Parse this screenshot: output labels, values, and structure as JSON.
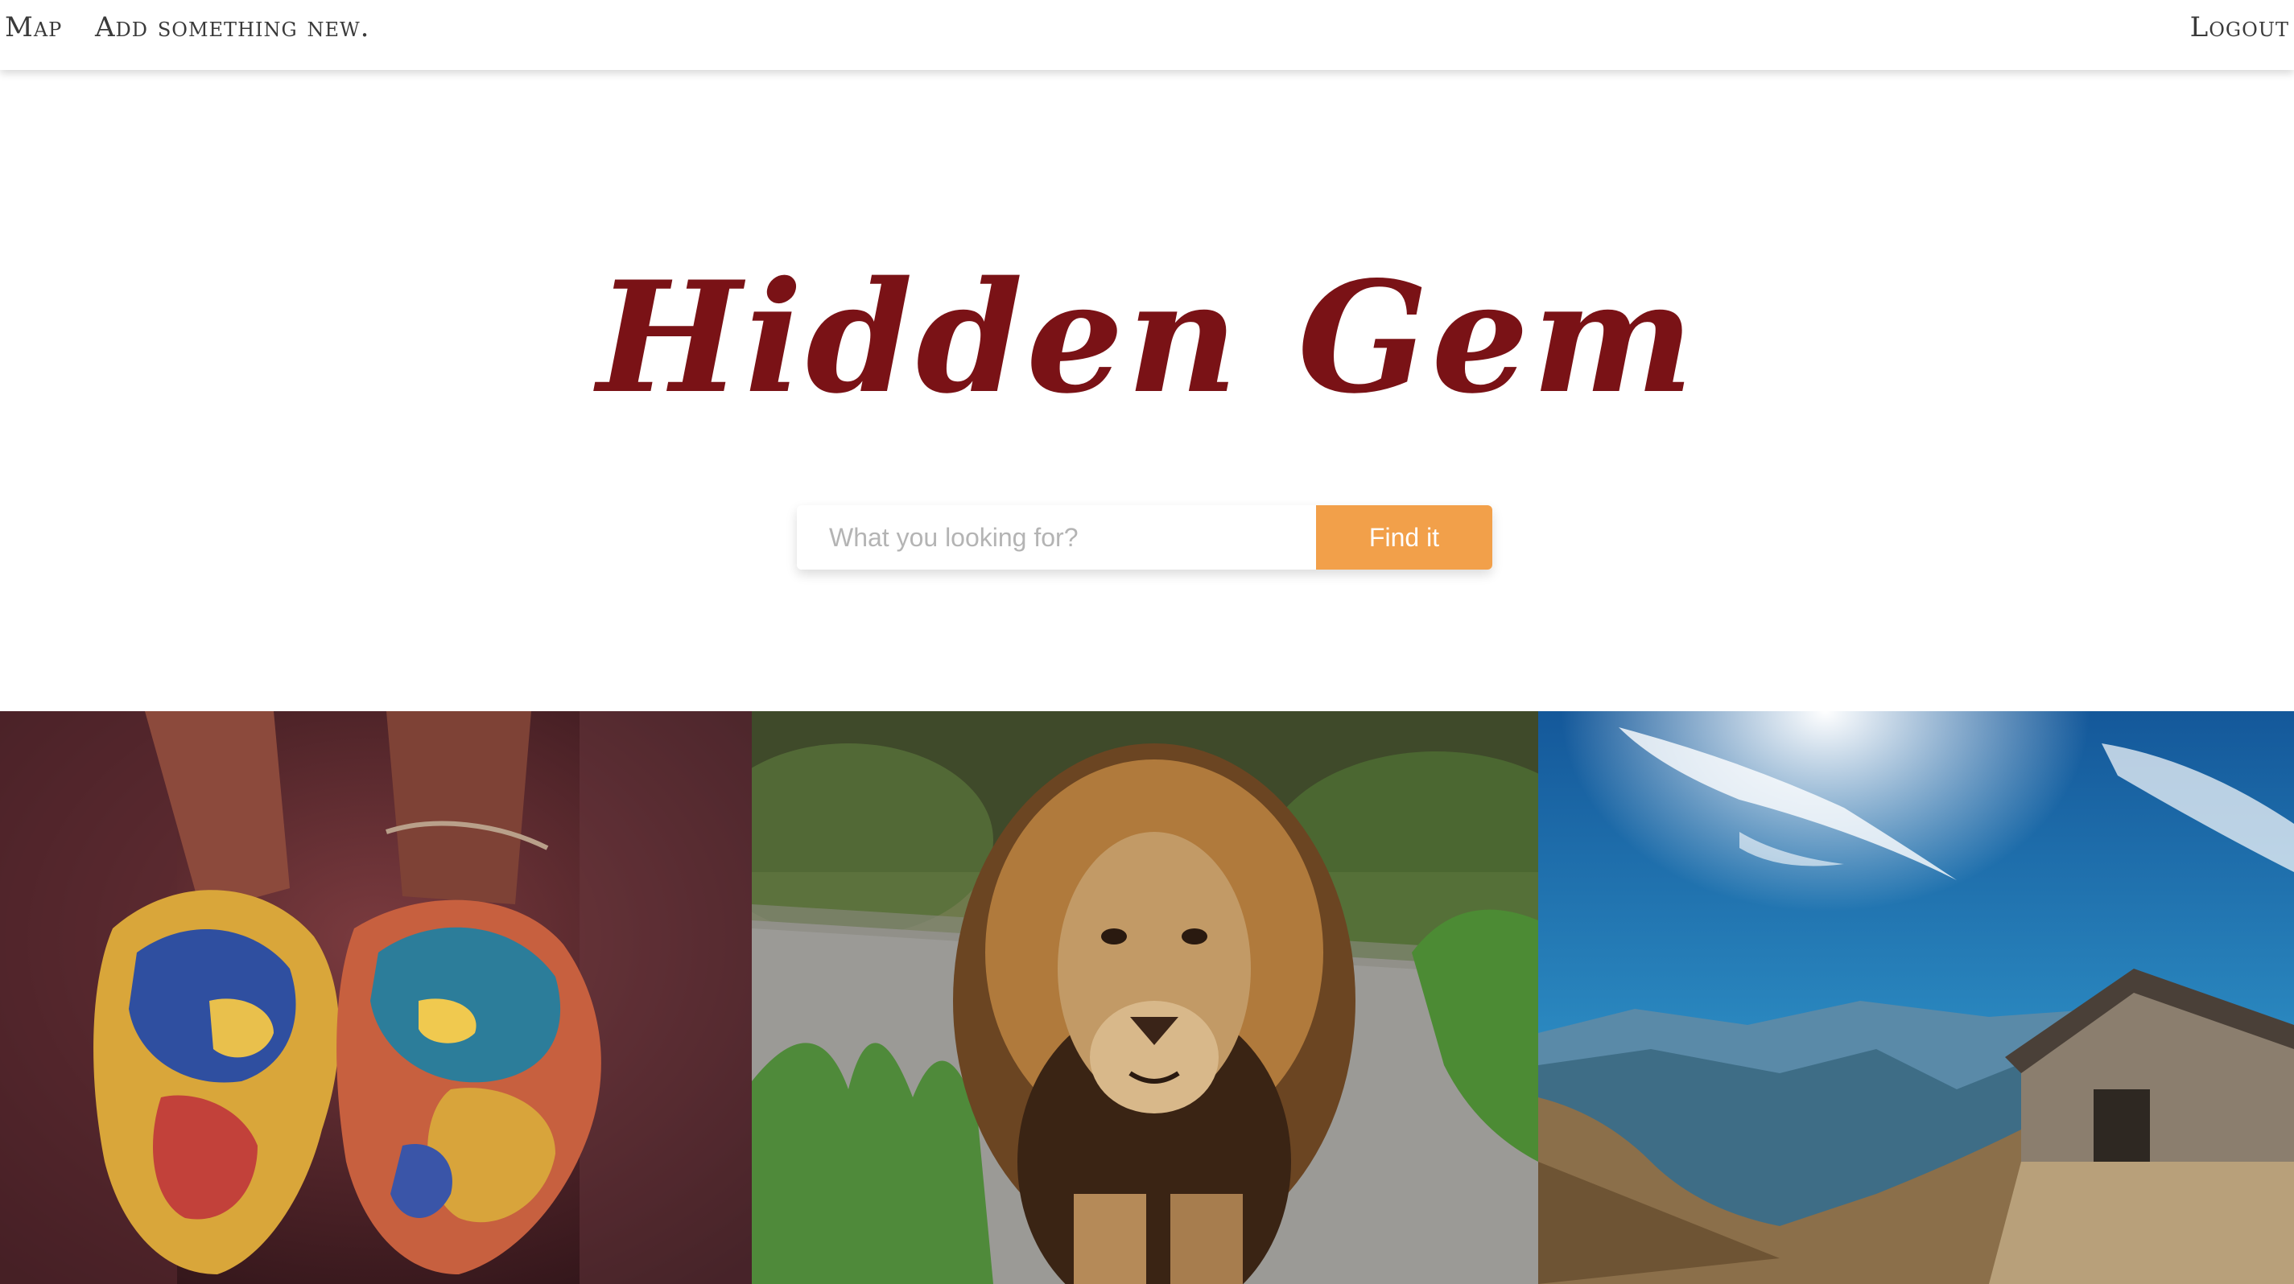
{
  "nav": {
    "map_label": "Map",
    "add_label": "Add something new.",
    "logout_label": "Logout"
  },
  "hero": {
    "title": "Hidden Gem"
  },
  "search": {
    "placeholder": "What you looking for?",
    "value": "",
    "button_label": "Find it"
  },
  "colors": {
    "title": "#7a1216",
    "accent_button": "#f2a04a",
    "nav_text": "#3a3a3a"
  },
  "gallery": {
    "images": [
      {
        "subject": "hands-covered-in-colored-powder"
      },
      {
        "subject": "lion-walking-on-road"
      },
      {
        "subject": "stone-hut-on-mountain-under-blue-sky"
      }
    ]
  }
}
